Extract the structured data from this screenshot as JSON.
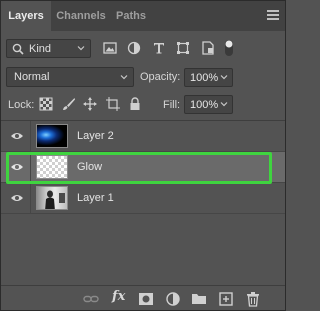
{
  "tabs": [
    {
      "label": "Layers",
      "active": true
    },
    {
      "label": "Channels",
      "active": false
    },
    {
      "label": "Paths",
      "active": false
    }
  ],
  "filter": {
    "kind_label": "Kind",
    "icons": [
      "image-filter-icon",
      "adjustment-filter-icon",
      "type-filter-icon",
      "shape-filter-icon",
      "smart-object-filter-icon",
      "filter-toggle-icon"
    ]
  },
  "blend_mode": {
    "value": "Normal"
  },
  "opacity": {
    "label": "Opacity:",
    "value": "100%"
  },
  "lock": {
    "label": "Lock:",
    "icons": [
      "lock-transparent-pixels-icon",
      "lock-image-pixels-icon",
      "lock-position-icon",
      "lock-artboard-icon",
      "lock-all-icon"
    ]
  },
  "fill": {
    "label": "Fill:",
    "value": "100%"
  },
  "layers": [
    {
      "name": "Layer 2",
      "visible": true,
      "selected": false,
      "thumbnail": "blue-glow-on-black"
    },
    {
      "name": "Glow",
      "visible": true,
      "selected": true,
      "thumbnail": "transparent-checkerboard"
    },
    {
      "name": "Layer 1",
      "visible": true,
      "selected": false,
      "thumbnail": "photo"
    }
  ],
  "bottom_toolbar": {
    "fx_label": "fx",
    "icons": [
      "link-layers-icon",
      "layer-style-icon",
      "add-mask-icon",
      "adjustment-layer-icon",
      "group-folder-icon",
      "new-layer-icon",
      "delete-icon"
    ]
  },
  "colors": {
    "panel": "#535353",
    "tab_bar": "#424242",
    "selected_row": "#6a6a6a",
    "highlight": "#3fd43f"
  }
}
